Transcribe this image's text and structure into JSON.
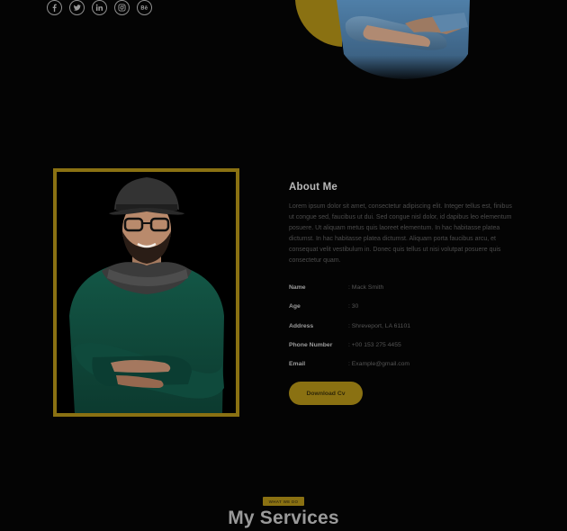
{
  "social": [
    {
      "icon": "facebook-icon",
      "glyph": "f"
    },
    {
      "icon": "twitter-icon",
      "glyph": ""
    },
    {
      "icon": "linkedin-icon",
      "glyph": "in"
    },
    {
      "icon": "instagram-icon",
      "glyph": ""
    },
    {
      "icon": "behance-icon",
      "glyph": "Bē"
    }
  ],
  "about": {
    "title": "About Me",
    "text": "Lorem ipsum dolor sit amet, consectetur adipiscing elit. Integer tellus est, finibus ut congue sed, faucibus ut dui. Sed congue nisl dolor, id dapibus leo elementum posuere. Ut aliquam metus quis laoreet elementum. In hac habitasse platea dictumst. In hac habitasse platea dictumst. Aliquam porta faucibus arcu, et consequat velit vestibulum in. Donec quis tellus ut nisi volutpat posuere quis consectetur quam.",
    "info": [
      {
        "label": "Name",
        "value": ": Mack Smith"
      },
      {
        "label": "Age",
        "value": ": 30"
      },
      {
        "label": "Address",
        "value": ": Shreveport, LA 61101"
      },
      {
        "label": "Phone Number",
        "value": ": +00 153 275 4455"
      },
      {
        "label": "Email",
        "value": ": Example@gmail.com"
      }
    ],
    "download_label": "Download Cv"
  },
  "services": {
    "badge": "WHAT WE DO",
    "title": "My Services"
  },
  "colors": {
    "accent": "#8a7112",
    "background": "#040404"
  }
}
